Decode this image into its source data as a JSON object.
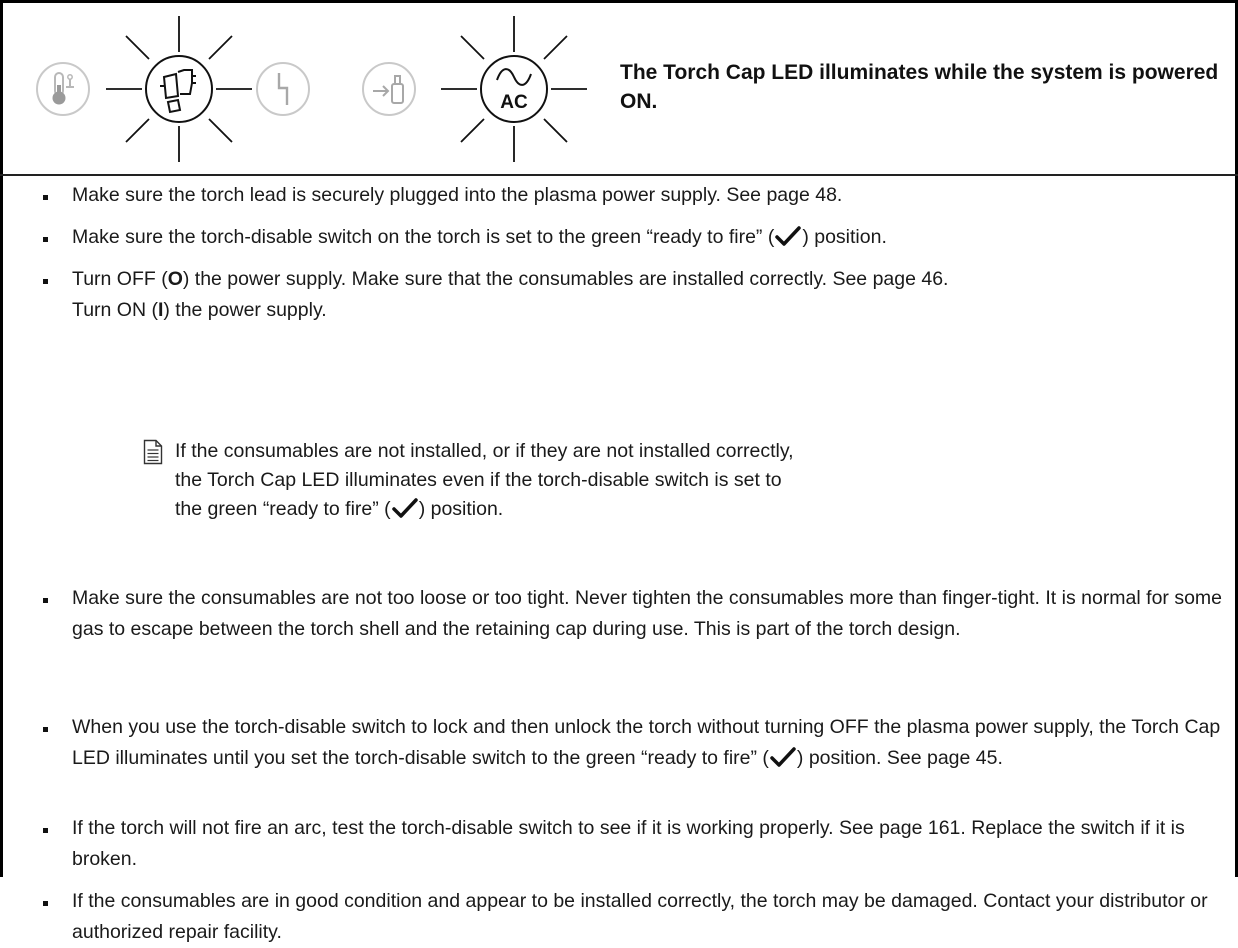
{
  "status": {
    "message": "The Torch Cap LED illuminates while the system is powered ON."
  },
  "leds": [
    {
      "name": "temperature-led",
      "icon": "thermometer-icon",
      "state": "off"
    },
    {
      "name": "torch-cap-led",
      "icon": "torch-cap-icon",
      "state": "illuminated"
    },
    {
      "name": "fault-led",
      "icon": "fault-icon",
      "state": "off"
    },
    {
      "name": "gas-pressure-led",
      "icon": "gas-cylinder-icon",
      "state": "off"
    },
    {
      "name": "ac-power-led",
      "icon": "ac-icon",
      "label": "AC",
      "state": "illuminated"
    }
  ],
  "bullets": {
    "b1": "Make sure the torch lead is securely plugged into the plasma power supply. See page 48.",
    "b2_pre": "Make sure the torch-disable switch on the torch is set to the green “ready to fire” (",
    "b2_post": ") position.",
    "b3_a": "Turn OFF (",
    "b3_b": "O",
    "b3_c": ") the power supply. Make sure that the consumables are installed correctly. See page 46.",
    "b3_d": "Turn ON (",
    "b3_e": "I",
    "b3_f": ") the power supply.",
    "b4": "Make sure the consumables are not too loose or too tight. Never tighten the consumables more than finger-tight. It is normal for some gas to escape between the torch shell and the retaining cap during use. This is part of the torch design.",
    "b5_pre": "When you use the torch-disable switch to lock and then unlock the torch without turning OFF the plasma power supply, the Torch Cap LED illuminates until you set the torch-disable switch to the green “ready to fire” (",
    "b5_post": ") position. See page 45.",
    "b6": "If the torch will not fire an arc, test the torch-disable switch to see if it is working properly. See page 161. Replace the switch if it is broken.",
    "b7": "If the consumables are in good condition and appear to be installed correctly, the torch may be damaged. Contact your distributor or authorized repair facility."
  },
  "note": {
    "line1": "If the consumables are not installed, or if they are not installed correctly,",
    "line2": "the Torch Cap LED illuminates even if the torch-disable switch is set to",
    "line3_pre": "the green “ready to fire” (",
    "line3_post": ") position."
  }
}
